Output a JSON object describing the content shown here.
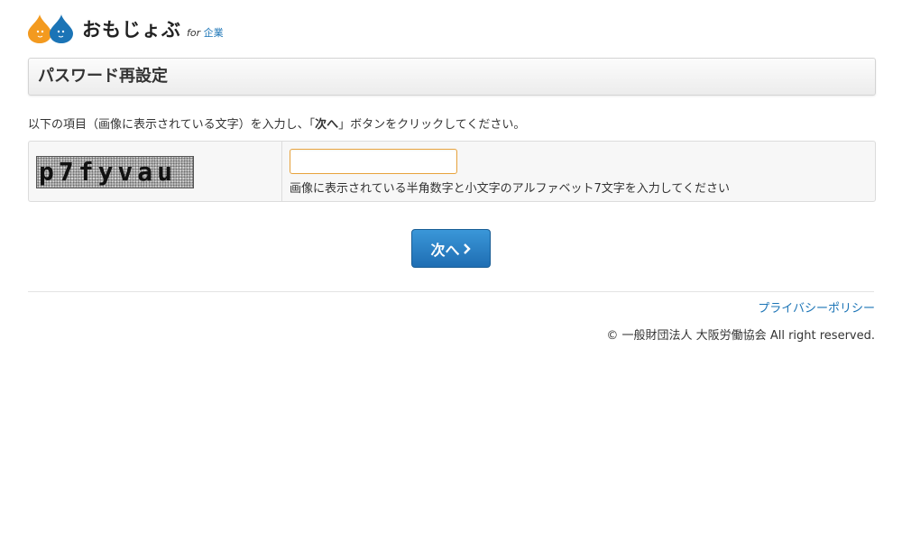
{
  "header": {
    "logo_text": "おもじょぶ",
    "logo_for": "for",
    "logo_kigyo": "企業",
    "colors": {
      "orange": "#f39a1f",
      "blue": "#1b74b6"
    }
  },
  "page": {
    "title": "パスワード再設定"
  },
  "instruction": {
    "before": "以下の項目（画像に表示されている文字）を入力し、「",
    "button_ref": "次へ",
    "after": "」ボタンをクリックしてください。"
  },
  "captcha": {
    "text": "p7fyvau",
    "input_value": "",
    "input_placeholder": "",
    "help": "画像に表示されている半角数字と小文字のアルファベット7文字を入力してください"
  },
  "actions": {
    "next_label": "次へ"
  },
  "footer": {
    "privacy": "プライバシーポリシー",
    "copyright": "© 一般財団法人 大阪労働協会 All right reserved."
  }
}
